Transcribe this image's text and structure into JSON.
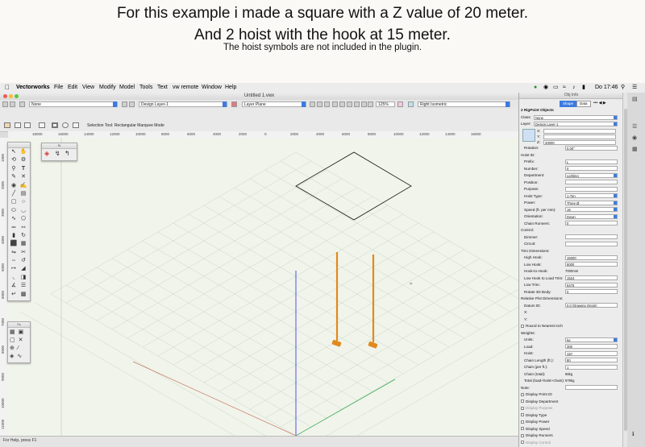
{
  "caption": {
    "line1": "For this example i made a square with a Z value of 20 meter.",
    "line2": "And 2 hoist with the hook at 15 meter.",
    "line3": "The hoist symbols are not included in the plugin."
  },
  "menubar": {
    "app": "Vectorworks",
    "items": [
      "File",
      "Edit",
      "View",
      "Modify",
      "Model",
      "Tools",
      "Text",
      "vw remote",
      "Window",
      "Help"
    ],
    "clock": "Do 17:46"
  },
  "window": {
    "title": "Untitled 1.vwx"
  },
  "toolbar": {
    "class_select": "None",
    "layer_select": "Design Layer-1",
    "layer_plane": "Layer Plane",
    "zoom": "125%",
    "view": "Right Isometric"
  },
  "modebar": {
    "status": "Selection Tool: Rectangular Marquee Mode"
  },
  "rulers": {
    "top": [
      "18000",
      "16000",
      "14000",
      "12000",
      "10000",
      "8000",
      "6000",
      "4000",
      "2000",
      "0",
      "2000",
      "4000",
      "6000",
      "8000",
      "10000",
      "12000",
      "14000",
      "16000"
    ],
    "left": [
      "1000",
      "2000",
      "3000",
      "4000",
      "5000",
      "6000",
      "7000",
      "8000",
      "9000",
      "10000",
      "11000"
    ]
  },
  "statusbar": {
    "text": "For Help, press F1"
  },
  "palettes": {
    "small_title": "Ri",
    "snap_title": "Ss"
  },
  "oip": {
    "title": "Obj Info",
    "tabs": [
      "Shape",
      "Data"
    ],
    "object_name": "2 RigPoint Objects",
    "class_label": "Class:",
    "class_value": "None",
    "layer_label": "Layer:",
    "layer_value": "Design Layer-1",
    "x_label": "X:",
    "y_label": "Y:",
    "z_label": "Z:",
    "z_value": "20000",
    "rows": [
      {
        "label": "Rotation:",
        "value": "0.00°",
        "kind": "field"
      },
      {
        "label": "Hoist ID:",
        "value": "",
        "kind": "section"
      },
      {
        "label": "Prefix:",
        "value": "L",
        "kind": "field"
      },
      {
        "label": "Number:",
        "value": "0",
        "kind": "field"
      },
      {
        "label": "Department:",
        "value": "Lighting",
        "kind": "select"
      },
      {
        "label": "Position:",
        "value": "",
        "kind": "field"
      },
      {
        "label": "Purpose:",
        "value": "",
        "kind": "field"
      },
      {
        "label": "Hoist Type:",
        "value": "1-7pn",
        "kind": "select"
      },
      {
        "label": "Power:",
        "value": "Three Ø",
        "kind": "select"
      },
      {
        "label": "Speed (ft. per min):",
        "value": "16",
        "kind": "select"
      },
      {
        "label": "Orientation:",
        "value": "Down",
        "kind": "select"
      },
      {
        "label": "Chain Runners:",
        "value": "0",
        "kind": "field"
      },
      {
        "label": "Control:",
        "value": "",
        "kind": "section"
      },
      {
        "label": "Dimmer:",
        "value": "",
        "kind": "field"
      },
      {
        "label": "Circuit:",
        "value": "",
        "kind": "field"
      },
      {
        "label": "Trim Dimensions:",
        "value": "",
        "kind": "section"
      },
      {
        "label": "High Hook:",
        "value": "15000",
        "kind": "field"
      },
      {
        "label": "Low Hook:",
        "value": "8000",
        "kind": "field"
      },
      {
        "label": "Hook-to-Hook:",
        "value": "7000mm",
        "kind": "plain"
      },
      {
        "label": "Low Hook to Load Trim:",
        "value": "1524",
        "kind": "field"
      },
      {
        "label": "Low Trim:",
        "value": "6476",
        "kind": "field"
      },
      {
        "label": "Rotate 3D Body:",
        "value": "0",
        "kind": "field"
      },
      {
        "label": "Relative Plot Dimensions:",
        "value": "",
        "kind": "section"
      },
      {
        "label": "Datum ID:",
        "value": "0,0 (Drawing Origin)",
        "kind": "field"
      },
      {
        "label": "X:",
        "value": "",
        "kind": "plain"
      },
      {
        "label": "Y:",
        "value": "",
        "kind": "plain"
      },
      {
        "label": "Round to Nearest Inch",
        "value": "",
        "kind": "check"
      },
      {
        "label": "Weights:",
        "value": "",
        "kind": "section"
      },
      {
        "label": "Units:",
        "value": "kg",
        "kind": "select"
      },
      {
        "label": "Load:",
        "value": "300",
        "kind": "field"
      },
      {
        "label": "Hoist:",
        "value": "110",
        "kind": "field"
      },
      {
        "label": "Chain Length (ft.):",
        "value": "80",
        "kind": "field"
      },
      {
        "label": "Chain (per ft.):",
        "value": "1",
        "kind": "field"
      },
      {
        "label": "Chain (total):",
        "value": "66kg",
        "kind": "plain"
      },
      {
        "label": "Total (load+hoist+chain):",
        "value": "976kg",
        "kind": "plain"
      },
      {
        "label": "Note:",
        "value": "",
        "kind": "field"
      },
      {
        "label": "Display Point ID",
        "value": "",
        "kind": "check"
      },
      {
        "label": "Display Department",
        "value": "",
        "kind": "check"
      },
      {
        "label": "Display Purpose",
        "value": "",
        "kind": "check-dim"
      },
      {
        "label": "Display Type",
        "value": "",
        "kind": "check"
      },
      {
        "label": "Display Power",
        "value": "",
        "kind": "check"
      },
      {
        "label": "Display Speed",
        "value": "",
        "kind": "check"
      },
      {
        "label": "Display Runners",
        "value": "",
        "kind": "check"
      },
      {
        "label": "Display Control",
        "value": "",
        "kind": "check-dim"
      }
    ]
  },
  "colors": {
    "hoist": "#e08a1e",
    "grid": "#c5d7c9",
    "axis_blue": "#6a6cf0",
    "axis_green": "#3fae5e",
    "axis_red": "#c77a6b",
    "accent": "#3b7be0"
  }
}
